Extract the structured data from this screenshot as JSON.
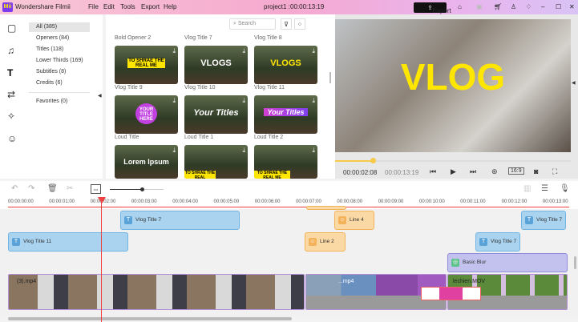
{
  "titlebar": {
    "logo": "Mii",
    "app_name": "Wondershare Filmii",
    "menu": [
      "File",
      "Edit",
      "Tools",
      "Export",
      "Help"
    ],
    "project": "project1 :",
    "duration": "00:00:13:19",
    "export_label": "Export"
  },
  "categories": [
    {
      "label": "All (385)"
    },
    {
      "label": "Openers (84)"
    },
    {
      "label": "Titles (118)"
    },
    {
      "label": "Lower Thirds (169)"
    },
    {
      "label": "Subtitles (8)"
    },
    {
      "label": "Credits (6)"
    },
    {
      "label": "Favorites (0)"
    }
  ],
  "library": {
    "search_placeholder": "Search",
    "items": [
      {
        "label": "Bold Opener 2",
        "text": "TO SHRAE THE REAL ME"
      },
      {
        "label": "Vlog Title 7",
        "text": "VLOGS"
      },
      {
        "label": "Vlog Title 8",
        "text": "VLOGS"
      },
      {
        "label": "Vlog Title 9",
        "text": "YOUR TITLE HERE"
      },
      {
        "label": "Vlog Title 10",
        "text": "Your Titles"
      },
      {
        "label": "Vlog Title 11",
        "text": "Your Titles"
      },
      {
        "label": "Loud Title",
        "text": "Lorem Ipsum"
      },
      {
        "label": "Loud Title 1",
        "text": "TO SHRAE THE REAL"
      },
      {
        "label": "Loud Title 2",
        "text": "TO SHRAE THE REAL ME"
      }
    ]
  },
  "preview": {
    "overlay_text": "VLOG",
    "current_time": "00:00:02:08",
    "total_time": "00:00:13:19",
    "aspect": "16:9",
    "progress": 0.16
  },
  "timeline": {
    "zoom_level": 0.6,
    "ruler": [
      "00:00:00:00",
      "00:00:01:00",
      "00:00:02:00",
      "00:00:03:00",
      "00:00:04:00",
      "00:00:05:00",
      "00:00:06:00",
      "00:00:07:00",
      "00:00:08:00",
      "00:00:09:00",
      "00:00:10:00",
      "00:00:11:00",
      "00:00:12:00",
      "00:00:13:00"
    ],
    "clips": {
      "vlog7a": "Vlog Title 7",
      "line4": "Line 4",
      "vlog7b": "Vlog Title 7",
      "vlog11": "Vlog Title 11",
      "line2": "Line 2",
      "vlog7c": "Vlog Title 7",
      "blur": "Basic Blur",
      "video1": "(3).mp4",
      "video2": "...mp4",
      "video3": "lechien.MOV"
    }
  }
}
